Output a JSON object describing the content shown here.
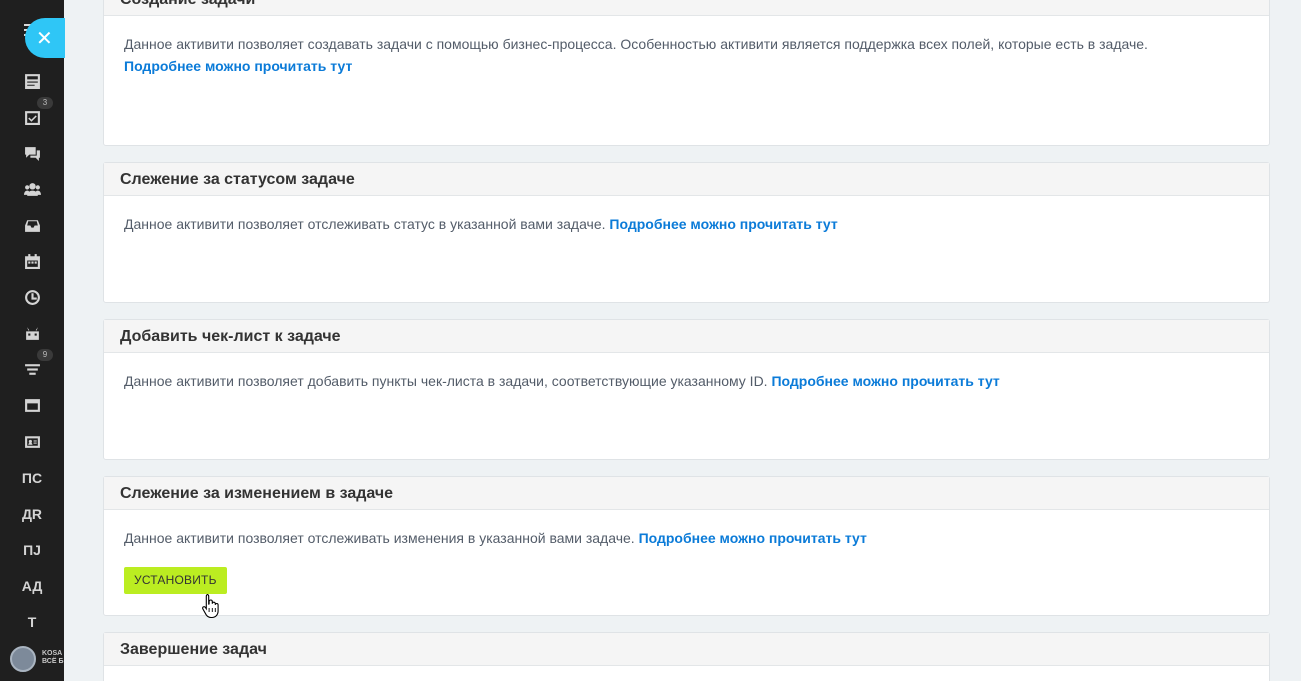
{
  "sidebar": {
    "close_symbol": "✕",
    "icons": [
      {
        "name": "feed-icon"
      },
      {
        "name": "tasks-icon",
        "badge": "3"
      },
      {
        "name": "chat-icon"
      },
      {
        "name": "group-icon"
      },
      {
        "name": "inbox-icon"
      },
      {
        "name": "calendar-icon"
      },
      {
        "name": "clock-icon"
      },
      {
        "name": "robot-icon"
      },
      {
        "name": "funnel-icon",
        "badge": "9"
      },
      {
        "name": "window-icon"
      },
      {
        "name": "contact-card-icon"
      }
    ],
    "text_items": [
      "ПС",
      "ДR",
      "ПJ",
      "АД",
      "Т"
    ],
    "logo_text_1": "KOSA",
    "logo_text_2": "ВСЁ Б"
  },
  "cards": [
    {
      "title": "Создание задачи",
      "description": "Данное активити позволяет создавать задачи с помощью бизнес-процесса. Особенностью активити является поддержка всех полей, которые есть в задаче.",
      "link": "Подробнее можно прочитать тут"
    },
    {
      "title": "Слежение за статусом задаче",
      "description": "Данное активити позволяет отслеживать статус в указанной вами задаче.",
      "link": "Подробнее можно прочитать тут"
    },
    {
      "title": "Добавить чек-лист к задаче",
      "description": "Данное активити позволяет добавить пункты чек-листа в задачи, соответствующие указанному ID.",
      "link": "Подробнее можно прочитать тут"
    },
    {
      "title": "Слежение за изменением в задаче",
      "description": "Данное активити позволяет отслеживать изменения в указанной вами задаче.",
      "link": "Подробнее можно прочитать тут",
      "button": "УСТАНОВИТЬ"
    },
    {
      "title": "Завершение задач"
    }
  ],
  "colors": {
    "accent_link": "#0b7bd8",
    "install_button": "#bbed21",
    "close_button": "#2fc6f6",
    "sidebar_bg": "#1f1f1f"
  }
}
